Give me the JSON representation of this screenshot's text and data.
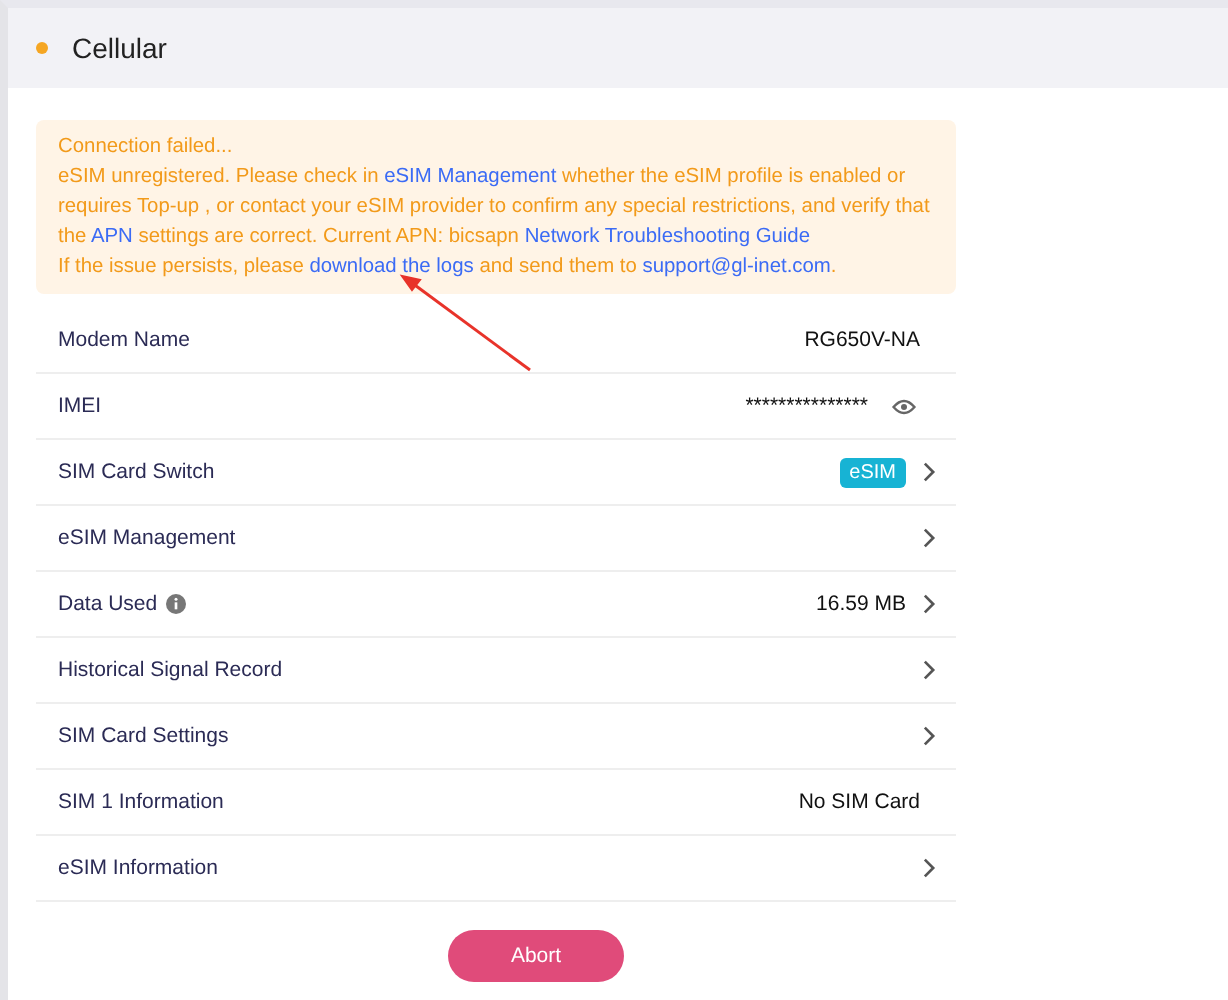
{
  "header": {
    "title": "Cellular"
  },
  "alert": {
    "paragraphs": [
      [
        {
          "text": "Connection failed...",
          "kind": "text"
        }
      ],
      [
        {
          "text": "eSIM unregistered. Please check in ",
          "kind": "text"
        },
        {
          "text": "eSIM Management",
          "kind": "link"
        },
        {
          "text": " whether the eSIM profile is enabled or requires Top-up , or contact your eSIM provider to confirm any special restrictions, and verify that the ",
          "kind": "text"
        },
        {
          "text": "APN",
          "kind": "link"
        },
        {
          "text": " settings are correct. Current APN: bicsapn ",
          "kind": "text"
        },
        {
          "text": "Network Troubleshooting Guide",
          "kind": "link"
        }
      ],
      [
        {
          "text": "If the issue persists, please ",
          "kind": "text"
        },
        {
          "text": "download the logs",
          "kind": "link"
        },
        {
          "text": " and send them to ",
          "kind": "text"
        },
        {
          "text": "support@gl-inet.com",
          "kind": "link"
        },
        {
          "text": ".",
          "kind": "text"
        }
      ]
    ]
  },
  "rows": [
    {
      "label": "Modem Name",
      "value": "RG650V-NA",
      "kind": "text",
      "chevron": false,
      "info": false
    },
    {
      "label": "IMEI",
      "value": "***************",
      "kind": "masked",
      "chevron": false,
      "info": false
    },
    {
      "label": "SIM Card Switch",
      "value": "eSIM",
      "kind": "badge",
      "chevron": true,
      "info": false
    },
    {
      "label": "eSIM Management",
      "chevron": true,
      "info": false
    },
    {
      "label": "Data Used",
      "value": "16.59 MB",
      "kind": "text",
      "chevron": true,
      "info": true
    },
    {
      "label": "Historical Signal Record",
      "chevron": true,
      "info": false
    },
    {
      "label": "SIM Card Settings",
      "chevron": true,
      "info": false
    },
    {
      "label": "SIM 1 Information",
      "value": "No SIM Card",
      "kind": "text",
      "chevron": false,
      "info": false
    },
    {
      "label": "eSIM Information",
      "chevron": true,
      "info": false
    }
  ],
  "abort_button": "Abort"
}
